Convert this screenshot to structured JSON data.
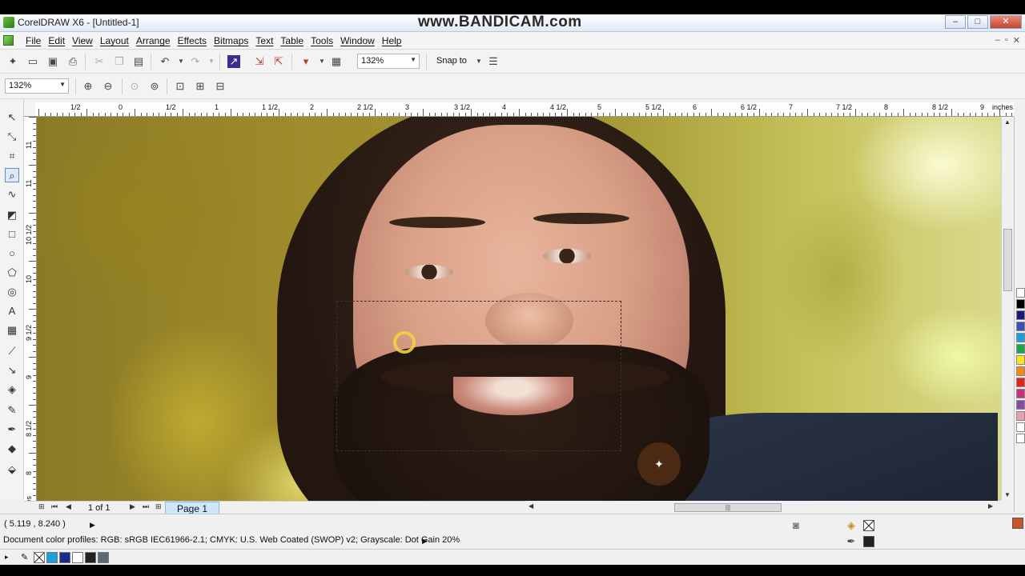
{
  "window": {
    "title": "CorelDRAW X6 - [Untitled-1]",
    "watermark": "www.BANDICAM.com",
    "controls": {
      "minimize": "–",
      "maximize": "□",
      "close": "✕"
    },
    "mdi_controls": {
      "minimize": "–",
      "restore": "▫",
      "close": "✕"
    }
  },
  "menu": {
    "items": [
      "File",
      "Edit",
      "View",
      "Layout",
      "Arrange",
      "Effects",
      "Bitmaps",
      "Text",
      "Table",
      "Tools",
      "Window",
      "Help"
    ]
  },
  "toolbar": {
    "zoom_combo": "132%",
    "snap_label": "Snap to"
  },
  "zoombar": {
    "zoom_combo": "132%"
  },
  "ruler": {
    "top_labels": [
      "1/2",
      "0",
      "1/2",
      "1",
      "1 1/2",
      "2",
      "2 1/2",
      "3",
      "3 1/2",
      "4",
      "4 1/2",
      "5",
      "5 1/2",
      "6",
      "6 1/2",
      "7",
      "7 1/2",
      "8",
      "8 1/2",
      "9",
      "inches"
    ],
    "left_labels": [
      "11",
      "11",
      "10 1/2",
      "10",
      "9 1/2",
      "9",
      "8 1/2",
      "8",
      "inches"
    ]
  },
  "pagenav": {
    "count": "1 of 1",
    "page_tab": "Page 1"
  },
  "status": {
    "coords": "( 5.119 , 8.240  )",
    "profiles": "Document color profiles: RGB: sRGB IEC61966-2.1; CMYK: U.S. Web Coated (SWOP) v2; Grayscale: Dot Gain 20%"
  },
  "colors": {
    "palette": [
      "#ffffff",
      "#000000",
      "#1a1a7a",
      "#3b4fb5",
      "#1aa0e0",
      "#19a849",
      "#f5e61b",
      "#f08c1a",
      "#e2231a",
      "#c8327a",
      "#8a4aa0",
      "#e8a0b0",
      "#ffffff",
      "#ffffff"
    ],
    "bottom": [
      "#1aa0e0",
      "#1a2a8a",
      "#ffffff",
      "#222222",
      "#5a6a7a"
    ]
  }
}
